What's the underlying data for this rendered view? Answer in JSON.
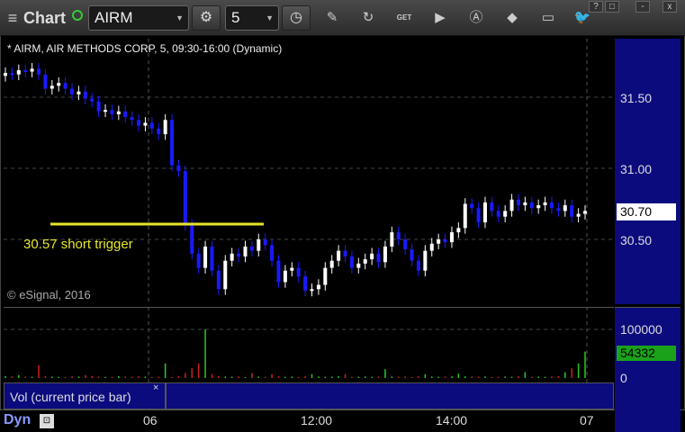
{
  "toolbar": {
    "menu_icon": "menu-icon",
    "title": "Chart",
    "symbol": "AIRM",
    "interval": "5",
    "tools": [
      "pencil-icon",
      "refresh-icon",
      "get-icon",
      "play-icon",
      "a-icon",
      "eraser-icon",
      "chat-icon",
      "twitter-icon"
    ],
    "window_buttons": [
      "?",
      "□",
      "-",
      "x"
    ],
    "get_label": "GET"
  },
  "chart": {
    "title": "* AIRM, AIR METHODS CORP, 5, 09:30-16:00 (Dynamic)",
    "watermark": "© eSignal, 2016",
    "annotation": "30.57 short trigger",
    "current_price": "30.70",
    "current_volume": "54332",
    "volume_title": "Vol (current price bar)",
    "mode": "Dyn",
    "colors": {
      "background": "#000000",
      "axis": "#0b0b7e",
      "up": "#ffffff",
      "down": "#1a1aff",
      "trigger_line": "#e6e62a",
      "vol_up": "#22cc22",
      "vol_down": "#cc2222"
    }
  },
  "chart_data": {
    "type": "candlestick",
    "price_ticks": [
      "31.50",
      "31.00",
      "30.50"
    ],
    "price_tick_values": [
      31.5,
      31.0,
      30.5
    ],
    "volume_ticks": [
      "100000",
      "0"
    ],
    "volume_tick_values": [
      100000,
      0
    ],
    "time_ticks": [
      "06",
      "12:00",
      "14:00",
      "07"
    ],
    "trigger_level": 30.57,
    "close_series": [
      31.67,
      31.66,
      31.69,
      31.68,
      31.7,
      31.66,
      31.56,
      31.58,
      31.6,
      31.56,
      31.52,
      31.54,
      31.49,
      31.47,
      31.4,
      31.41,
      31.38,
      31.4,
      31.36,
      31.34,
      31.3,
      31.32,
      31.28,
      31.24,
      31.34,
      31.02,
      30.98,
      30.6,
      30.4,
      30.3,
      30.45,
      30.28,
      30.15,
      30.35,
      30.4,
      30.38,
      30.45,
      30.42,
      30.5,
      30.46,
      30.35,
      30.2,
      30.28,
      30.3,
      30.24,
      30.14,
      30.15,
      30.18,
      30.3,
      30.35,
      30.42,
      30.38,
      30.3,
      30.33,
      30.36,
      30.4,
      30.34,
      30.45,
      30.55,
      30.5,
      30.43,
      30.35,
      30.28,
      30.42,
      30.47,
      30.5,
      30.48,
      30.55,
      30.58,
      30.75,
      30.72,
      30.62,
      30.76,
      30.7,
      30.66,
      30.7,
      30.78,
      30.74,
      30.76,
      30.72,
      30.74,
      30.76,
      30.72,
      30.7,
      30.74,
      30.66,
      30.68,
      30.7
    ],
    "volume_series": [
      4000,
      3500,
      6000,
      3000,
      2500,
      26000,
      4000,
      3000,
      2500,
      2000,
      3500,
      3000,
      6000,
      4000,
      3000,
      2500,
      2000,
      4000,
      3000,
      2500,
      3500,
      3000,
      2000,
      2500,
      30000,
      2000,
      4000,
      10000,
      20000,
      30000,
      100000,
      8000,
      4000,
      3000,
      2500,
      3000,
      2000,
      10000,
      3000,
      2500,
      8000,
      3500,
      2500,
      3000,
      2000,
      4000,
      8000,
      3000,
      2500,
      3000,
      4000,
      8000,
      2000,
      2500,
      3000,
      2500,
      3000,
      18000,
      3000,
      2500,
      3000,
      2000,
      3500,
      8000,
      3000,
      2500,
      3000,
      3500,
      9000,
      3500,
      3000,
      2500,
      3000,
      2000,
      2500,
      3000,
      2500,
      3500,
      12000,
      2500,
      3000,
      2500,
      3000,
      4000,
      12000,
      20000,
      30000,
      54332
    ]
  }
}
